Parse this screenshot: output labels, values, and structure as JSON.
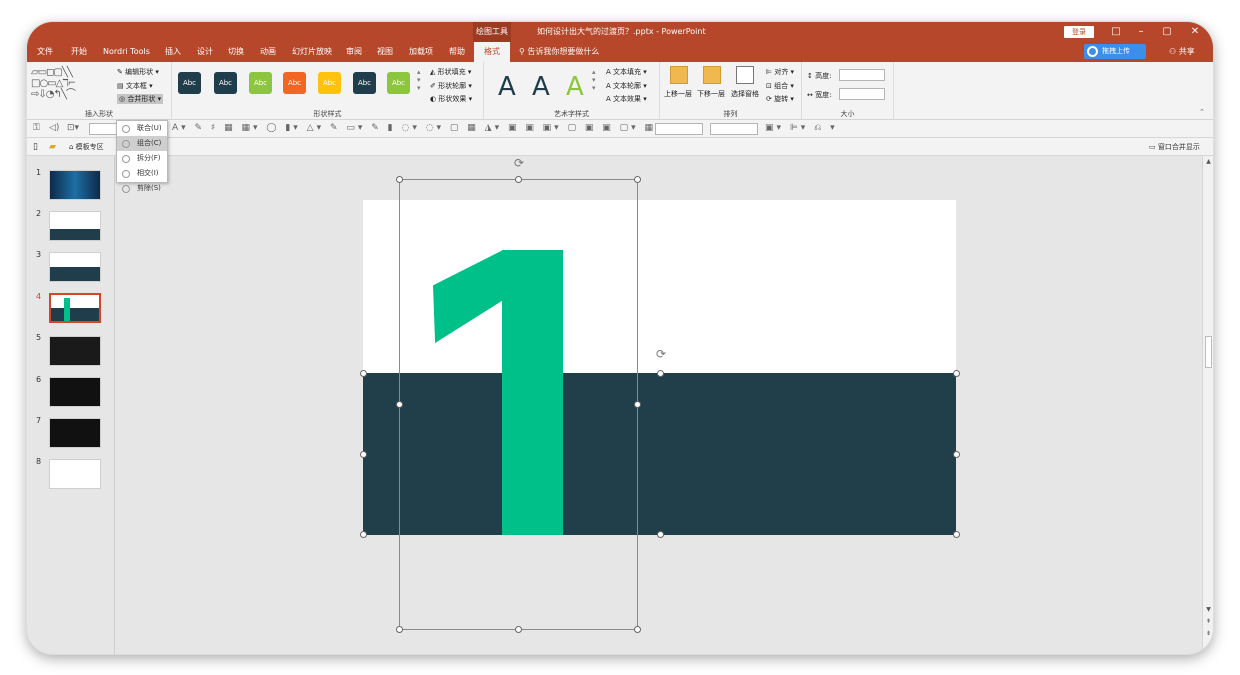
{
  "window": {
    "context_group": "绘图工具",
    "doc_title": "如何设计出大气的过渡页？.pptx - PowerPoint",
    "login": "登录",
    "restore": "□",
    "minimize": "–",
    "maximize": "▢",
    "close": "✕"
  },
  "tabs": [
    "文件",
    "开始",
    "Nordri Tools",
    "插入",
    "设计",
    "切换",
    "动画",
    "幻灯片放映",
    "审阅",
    "视图",
    "加载项",
    "帮助",
    "格式"
  ],
  "tell_me": "告诉我你想要做什么",
  "baidu_upload": "拖拽上传",
  "share": "共享",
  "ribbon": {
    "insert_shapes": {
      "label": "插入形状",
      "edit_shape": "编辑形状",
      "text_box": "文本框",
      "merge_shapes": "合并形状"
    },
    "shape_styles": {
      "label": "形状样式",
      "sample": "Abc",
      "fill": "形状填充",
      "outline": "形状轮廓",
      "effects": "形状效果"
    },
    "wordart": {
      "label": "艺术字样式",
      "sample": "A",
      "text_fill": "文本填充",
      "text_outline": "文本轮廓",
      "text_effects": "文本效果"
    },
    "arrange": {
      "label": "排列",
      "bring_forward": "上移一层",
      "send_backward": "下移一层",
      "selection_pane": "选择窗格",
      "align": "对齐",
      "group": "组合",
      "rotate": "旋转"
    },
    "size": {
      "label": "大小",
      "height": "高度:",
      "width": "宽度:"
    }
  },
  "merge_menu": [
    {
      "label": "联合(U)",
      "selected": false
    },
    {
      "label": "组合(C)",
      "selected": true
    },
    {
      "label": "拆分(F)",
      "selected": false
    },
    {
      "label": "相交(I)",
      "selected": false
    },
    {
      "label": "剪除(S)",
      "selected": false
    }
  ],
  "toolbar3": {
    "template_zone": "模板专区",
    "merge_windows": "窗口合并显示"
  },
  "slides": [
    "1",
    "2",
    "3",
    "4",
    "5",
    "6",
    "7",
    "8"
  ],
  "current_slide": 4,
  "slide_content": {
    "big_digit": "1"
  },
  "colors": {
    "title_bar": "#b7472a",
    "accent_green": "#00c089",
    "dark_band": "#203f4b",
    "style_dark": "#1f3d4a",
    "style_green": "#8cc63f",
    "style_orange": "#f26522",
    "style_yellow": "#ffc20e"
  }
}
